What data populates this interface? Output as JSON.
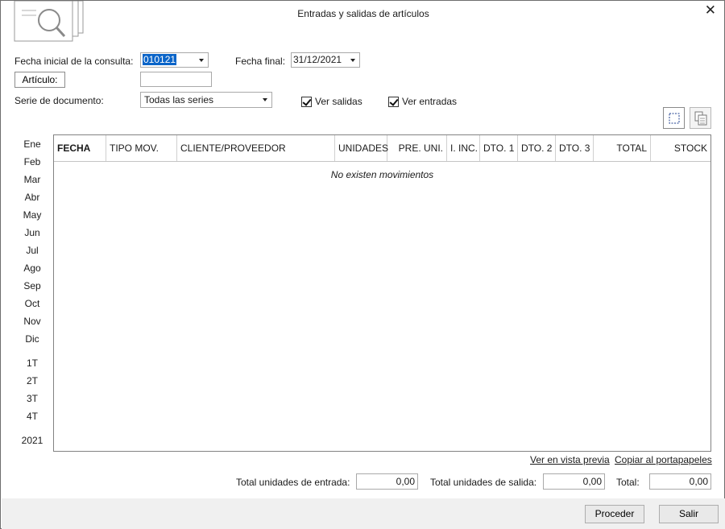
{
  "window": {
    "title": "Entradas y salidas de artículos",
    "close": "✕"
  },
  "form": {
    "fecha_inicial_label": "Fecha inicial de la consulta:",
    "fecha_inicial_value": "010121",
    "fecha_final_label": "Fecha final:",
    "fecha_final_value": "31/12/2021",
    "articulo_button": "Artículo:",
    "articulo_value": "",
    "serie_label": "Serie de documento:",
    "serie_value": "Todas las series",
    "ver_salidas": "Ver salidas",
    "ver_entradas": "Ver entradas"
  },
  "periods": {
    "months": [
      "Ene",
      "Feb",
      "Mar",
      "Abr",
      "May",
      "Jun",
      "Jul",
      "Ago",
      "Sep",
      "Oct",
      "Nov",
      "Dic"
    ],
    "quarters": [
      "1T",
      "2T",
      "3T",
      "4T"
    ],
    "year": "2021"
  },
  "table": {
    "columns": [
      "FECHA",
      "TIPO MOV.",
      "CLIENTE/PROVEEDOR",
      "UNIDADES",
      "PRE. UNI.",
      "I. INC.",
      "DTO. 1",
      "DTO. 2",
      "DTO. 3",
      "TOTAL",
      "STOCK"
    ],
    "empty_message": "No existen movimientos"
  },
  "links": {
    "preview": "Ver en vista previa",
    "clipboard": "Copiar al portapapeles"
  },
  "totals": {
    "entrada_label": "Total unidades de entrada:",
    "entrada_value": "0,00",
    "salida_label": "Total unidades de salida:",
    "salida_value": "0,00",
    "total_label": "Total:",
    "total_value": "0,00"
  },
  "footer": {
    "proceder": "Proceder",
    "salir": "Salir"
  }
}
